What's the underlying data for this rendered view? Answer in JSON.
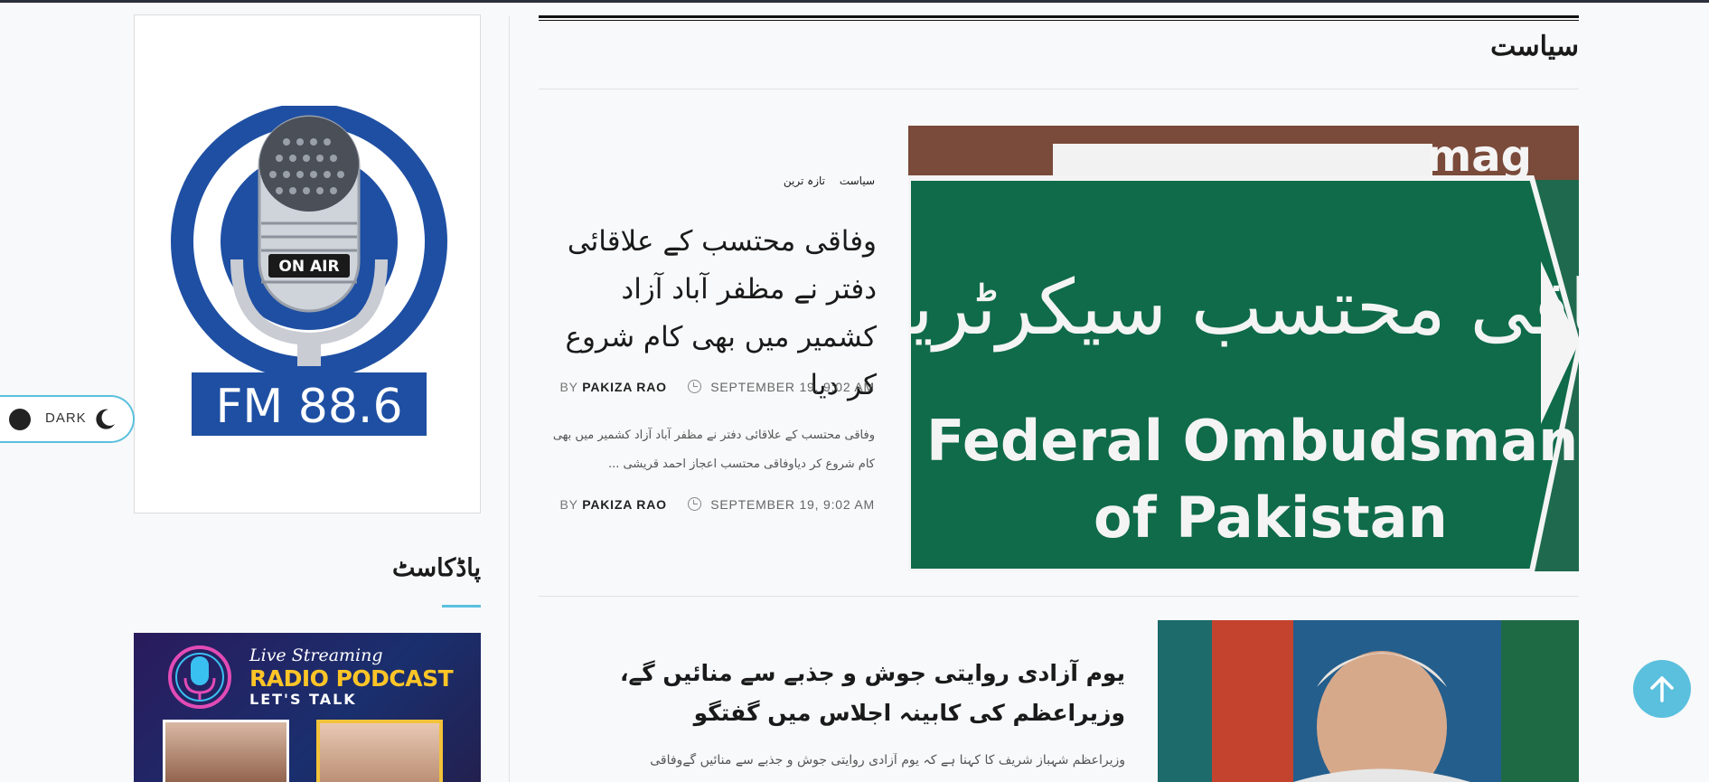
{
  "sidebar": {
    "radio": {
      "logo_badge": "ON AIR",
      "frequency": "FM 88.6"
    },
    "podcast": {
      "heading": "پاڈکاسٹ",
      "banner": {
        "script_text": "Live Streaming",
        "title": "RADIO PODCAST",
        "subtitle": "LET'S TALK"
      }
    }
  },
  "theme_toggle": {
    "label": "DARK"
  },
  "section": {
    "title": "سیاست"
  },
  "articles": [
    {
      "categories": [
        "سیاست",
        "تازہ ترین"
      ],
      "title": "وفاقی محتسب کے علاقائی دفتر نے مظفر آباد آزاد کشمیر میں بھی کام شروع کر دیا",
      "meta": {
        "by": "BY",
        "author": "PAKIZA RAO",
        "date": "SEPTEMBER 19, 9:02 AM"
      },
      "excerpt": "وفاقی محتسب کے علاقائی دفتر نے مظفر آباد آزاد کشمیر میں بھی کام شروع کر دیاوفاقی محتسب اعجاز احمد قریشی ...",
      "meta2": {
        "by": "BY",
        "author": "PAKIZA RAO",
        "date": "SEPTEMBER 19, 9:02 AM"
      },
      "image_sign": {
        "urdu": "وفاقی محتسب سیکرٹریٹ",
        "line1": "Federal Ombudsman",
        "line2": "of Pakistan",
        "corner": "mag"
      }
    },
    {
      "title": "یوم آزادی روایتی جوش و جذبے سے منائیں گے، وزیراعظم کی کابینہ اجلاس میں گفتگو",
      "excerpt": "وزیراعظم شہباز شریف کا کہنا ہے کہ یوم آزادی روایتی جوش و جذبے سے منائیں گےوفاقی"
    }
  ],
  "colors": {
    "accent": "#5bc0de",
    "sign_green": "#0f6b4a",
    "radio_blue": "#1e4fa3"
  }
}
